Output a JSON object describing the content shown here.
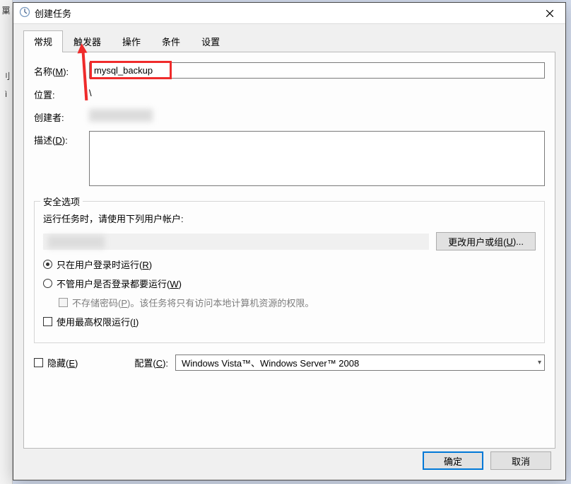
{
  "window": {
    "title": "创建任务"
  },
  "tabs": {
    "general": "常规",
    "triggers": "触发器",
    "actions": "操作",
    "conditions": "条件",
    "settings": "设置"
  },
  "labels": {
    "name_pre": "名称(",
    "name_u": "M",
    "name_post": "):",
    "location": "位置:",
    "author": "创建者:",
    "desc_pre": "描述(",
    "desc_u": "D",
    "desc_post": "):",
    "security_legend": "安全选项",
    "run_as_msg": "运行任务时，请使用下列用户帐户:",
    "change_user_pre": "更改用户或组(",
    "change_user_u": "U",
    "change_user_post": ")...",
    "radio_logged_pre": "只在用户登录时运行(",
    "radio_logged_u": "R",
    "radio_logged_post": ")",
    "radio_any_pre": "不管用户是否登录都要运行(",
    "radio_any_u": "W",
    "radio_any_post": ")",
    "nosave_pre": "不存储密码(",
    "nosave_u": "P",
    "nosave_post": ")。该任务将只有访问本地计算机资源的权限。",
    "highest_pre": "使用最高权限运行(",
    "highest_u": "I",
    "highest_post": ")",
    "hidden_pre": "隐藏(",
    "hidden_u": "E",
    "hidden_post": ")",
    "config_pre": "配置(",
    "config_u": "C",
    "config_post": "):"
  },
  "values": {
    "name": "mysql_backup",
    "location": "\\",
    "author_blurred": "██████",
    "description": "",
    "run_as_account_blurred": "██████",
    "config_selected": "Windows Vista™、Windows Server™ 2008"
  },
  "buttons": {
    "ok": "确定",
    "cancel": "取消"
  }
}
